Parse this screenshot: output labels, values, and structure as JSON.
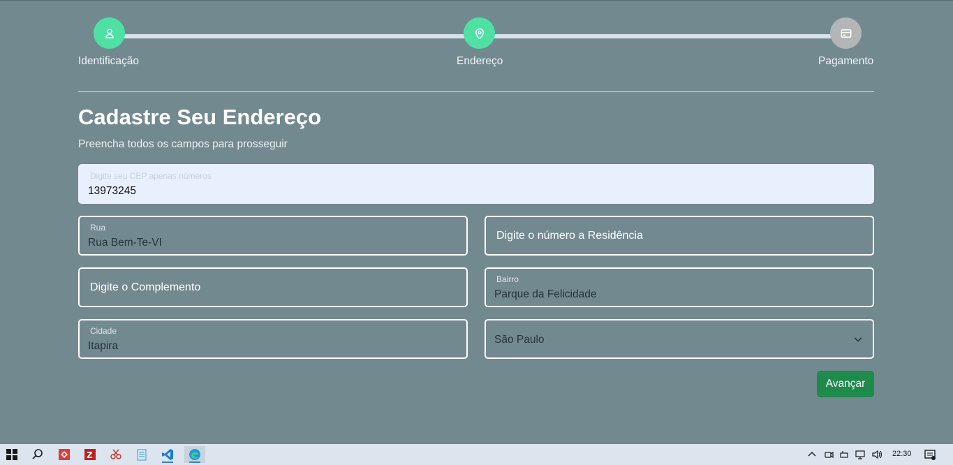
{
  "stepper": {
    "steps": [
      {
        "label": "Identificação",
        "icon": "user-icon",
        "state": "active"
      },
      {
        "label": "Endereço",
        "icon": "map-pin-icon",
        "state": "active"
      },
      {
        "label": "Pagamento",
        "icon": "credit-card-icon",
        "state": "inactive"
      }
    ]
  },
  "form": {
    "title": "Cadastre Seu Endereço",
    "subtitle": "Preencha todos os campos para prosseguir",
    "cep": {
      "label": "Digite seu CEP apenas números",
      "value": "13973245"
    },
    "rua": {
      "label": "Rua",
      "value": "Rua Bem-Te-VI"
    },
    "numero": {
      "placeholder": "Digite o número a Residência"
    },
    "complemento": {
      "placeholder": "Digite o Complemento"
    },
    "bairro": {
      "label": "Bairro",
      "value": "Parque da Felicidade"
    },
    "cidade": {
      "label": "Cidade",
      "value": "Itapira"
    },
    "estado": {
      "selected": "São Paulo"
    },
    "submit_label": "Avançar"
  },
  "colors": {
    "background": "#738990",
    "step_active": "#4fe0a3",
    "step_inactive": "#b3b5b6",
    "button": "#1e8a4c"
  },
  "taskbar": {
    "apps": [
      "windows-start-icon",
      "search-icon",
      "anydesk-icon",
      "filezilla-icon",
      "snipping-tool-icon",
      "notepad-icon",
      "vscode-icon",
      "edge-icon"
    ],
    "clock": "22:30"
  }
}
